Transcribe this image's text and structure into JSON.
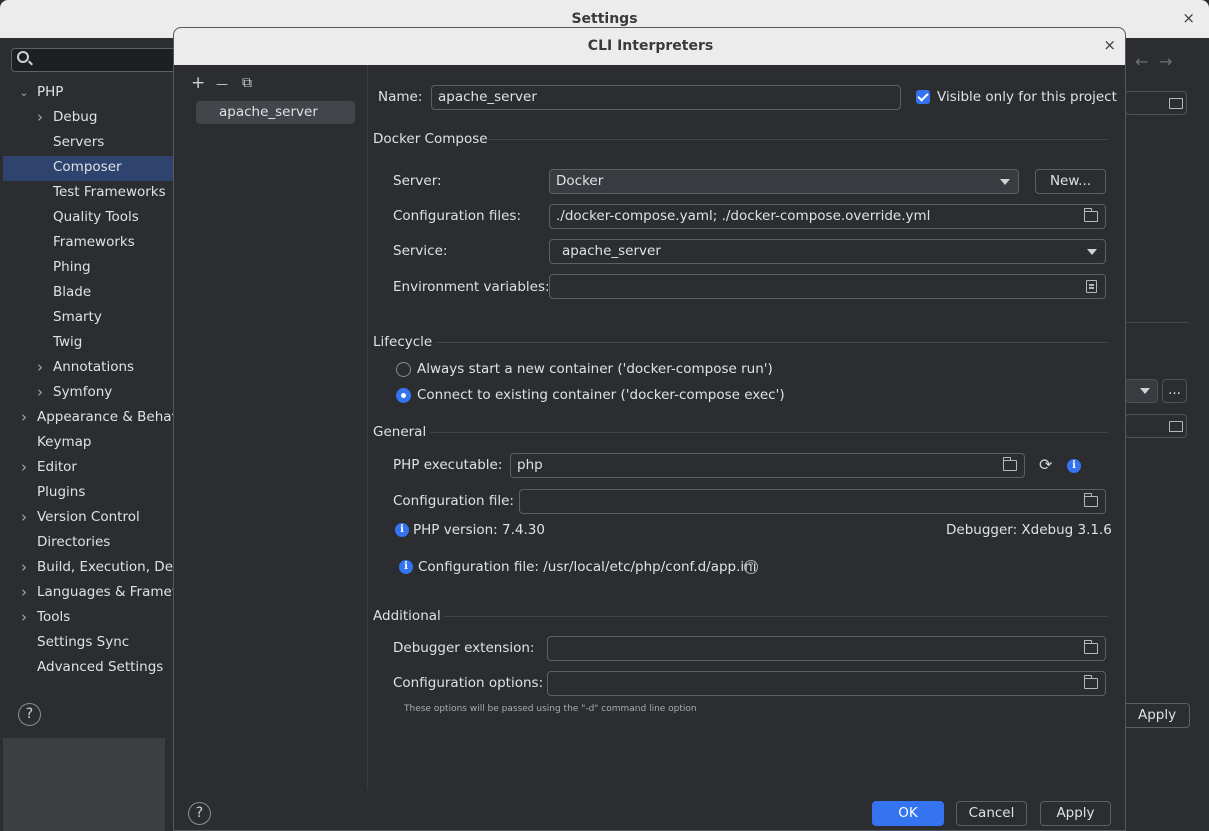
{
  "settings_window": {
    "title": "Settings",
    "close_glyph": "×",
    "apply_label": "Apply",
    "help_label": "?",
    "tree": [
      {
        "label": "PHP",
        "level": 0,
        "expanded": true
      },
      {
        "label": "Debug",
        "level": 1,
        "expandable": true
      },
      {
        "label": "Servers",
        "level": 1
      },
      {
        "label": "Composer",
        "level": 1,
        "selected": true
      },
      {
        "label": "Test Frameworks",
        "level": 1
      },
      {
        "label": "Quality Tools",
        "level": 1
      },
      {
        "label": "Frameworks",
        "level": 1
      },
      {
        "label": "Phing",
        "level": 1
      },
      {
        "label": "Blade",
        "level": 1
      },
      {
        "label": "Smarty",
        "level": 1
      },
      {
        "label": "Twig",
        "level": 1
      },
      {
        "label": "Annotations",
        "level": 1,
        "expandable": true
      },
      {
        "label": "Symfony",
        "level": 1,
        "expandable": true
      },
      {
        "label": "Appearance & Behavio",
        "level": 0,
        "expandable": true
      },
      {
        "label": "Keymap",
        "level": 0
      },
      {
        "label": "Editor",
        "level": 0,
        "expandable": true
      },
      {
        "label": "Plugins",
        "level": 0
      },
      {
        "label": "Version Control",
        "level": 0,
        "expandable": true
      },
      {
        "label": "Directories",
        "level": 0
      },
      {
        "label": "Build, Execution, Depl",
        "level": 0,
        "expandable": true
      },
      {
        "label": "Languages & Framewo",
        "level": 0,
        "expandable": true
      },
      {
        "label": "Tools",
        "level": 0,
        "expandable": true
      },
      {
        "label": "Settings Sync",
        "level": 0
      },
      {
        "label": "Advanced Settings",
        "level": 0
      }
    ]
  },
  "dialog": {
    "title": "CLI Interpreters",
    "close_glyph": "×",
    "toolbar": {
      "add": "+",
      "remove": "—",
      "copy": "⧉"
    },
    "interpreters": [
      "apache_server"
    ],
    "name_label": "Name:",
    "name_value": "apache_server",
    "visible_only_label": "Visible only for this project",
    "docker_compose": {
      "section_title": "Docker Compose",
      "server_label": "Server:",
      "server_value": "Docker",
      "new_button": "New...",
      "config_files_label": "Configuration files:",
      "config_files_value": "./docker-compose.yaml; ./docker-compose.override.yml",
      "service_label": "Service:",
      "service_value": "apache_server",
      "env_label": "Environment variables:",
      "env_value": ""
    },
    "lifecycle": {
      "section_title": "Lifecycle",
      "option_run": "Always start a new container ('docker-compose run')",
      "option_exec": "Connect to existing container ('docker-compose exec')",
      "selected": "exec"
    },
    "general": {
      "section_title": "General",
      "php_exec_label": "PHP executable:",
      "php_exec_value": "php",
      "config_file_label": "Configuration file:",
      "config_file_value": "",
      "php_version": "PHP version: 7.4.30",
      "debugger": "Debugger: Xdebug 3.1.6",
      "config_file_info": "Configuration file: /usr/local/etc/php/conf.d/app.ini"
    },
    "additional": {
      "section_title": "Additional",
      "debugger_ext_label": "Debugger extension:",
      "debugger_ext_value": "",
      "config_options_label": "Configuration options:",
      "config_options_value": "",
      "hint": "These options will be passed using the \"-d\" command line option"
    },
    "buttons": {
      "ok": "OK",
      "cancel": "Cancel",
      "apply": "Apply",
      "help": "?"
    },
    "colors": {
      "accent": "#3574f0",
      "background": "#2b2d30"
    }
  }
}
